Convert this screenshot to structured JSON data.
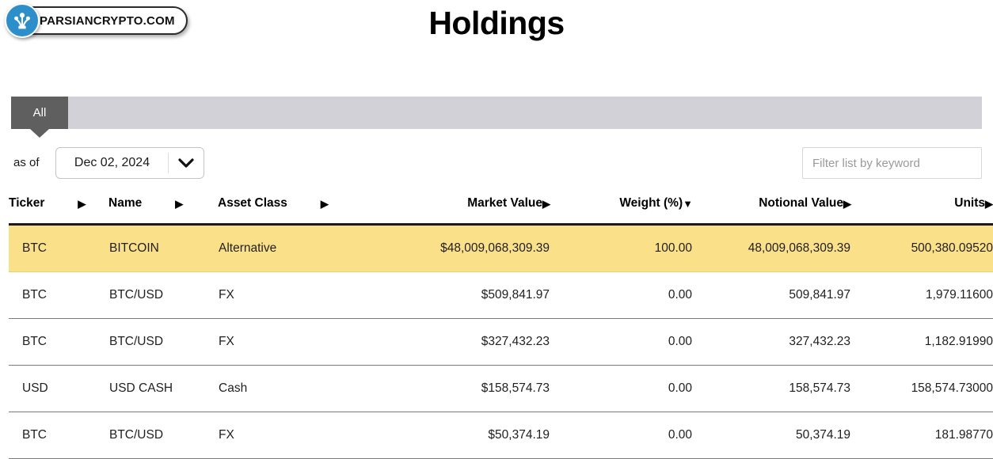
{
  "brand": {
    "logo_text": "PARSIANCRYPTO.COM",
    "logo_icon": "network-tree-icon",
    "logo_circle_color": "#2d8fc9"
  },
  "header": {
    "title": "Holdings"
  },
  "tabs": {
    "items": [
      {
        "label": "All",
        "active": true
      }
    ],
    "active_bg": "#5f5f5f",
    "strip_bg": "#d2d1d8"
  },
  "controls": {
    "asof_label": "as of",
    "date_value": "Dec 02, 2024",
    "date_chevron_icon": "chevron-down-icon",
    "filter_placeholder": "Filter list by keyword",
    "filter_value": ""
  },
  "table": {
    "columns": [
      {
        "key": "ticker",
        "label": "Ticker",
        "sort": "collapsed",
        "align": "left"
      },
      {
        "key": "name",
        "label": "Name",
        "sort": "collapsed",
        "align": "left"
      },
      {
        "key": "asset",
        "label": "Asset Class",
        "sort": "collapsed",
        "align": "left"
      },
      {
        "key": "market",
        "label": "Market Value",
        "sort": "collapsed",
        "align": "right"
      },
      {
        "key": "weight",
        "label": "Weight (%)",
        "sort": "desc",
        "align": "right"
      },
      {
        "key": "notional",
        "label": "Notional Value",
        "sort": "collapsed",
        "align": "right"
      },
      {
        "key": "units",
        "label": "Units",
        "sort": "collapsed",
        "align": "right"
      }
    ],
    "sort_glyph_collapsed": "▶",
    "sort_glyph_desc": "▼",
    "highlight_color": "#fbe08a",
    "rows": [
      {
        "ticker": "BTC",
        "name": "BITCOIN",
        "asset": "Alternative",
        "market": "$48,009,068,309.39",
        "weight": "100.00",
        "notional": "48,009,068,309.39",
        "units": "500,380.09520",
        "highlighted": true
      },
      {
        "ticker": "BTC",
        "name": "BTC/USD",
        "asset": "FX",
        "market": "$509,841.97",
        "weight": "0.00",
        "notional": "509,841.97",
        "units": "1,979.11600",
        "highlighted": false
      },
      {
        "ticker": "BTC",
        "name": "BTC/USD",
        "asset": "FX",
        "market": "$327,432.23",
        "weight": "0.00",
        "notional": "327,432.23",
        "units": "1,182.91990",
        "highlighted": false
      },
      {
        "ticker": "USD",
        "name": "USD CASH",
        "asset": "Cash",
        "market": "$158,574.73",
        "weight": "0.00",
        "notional": "158,574.73",
        "units": "158,574.73000",
        "highlighted": false
      },
      {
        "ticker": "BTC",
        "name": "BTC/USD",
        "asset": "FX",
        "market": "$50,374.19",
        "weight": "0.00",
        "notional": "50,374.19",
        "units": "181.98770",
        "highlighted": false
      }
    ]
  }
}
